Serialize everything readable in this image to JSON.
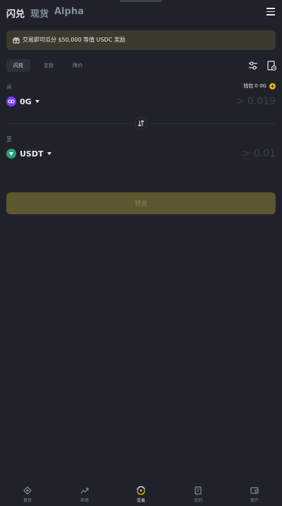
{
  "header": {
    "tabs": [
      {
        "label": "闪兑"
      },
      {
        "label": "现货"
      },
      {
        "label": "Alpha"
      }
    ],
    "menu_icon": "hamburger-menu-icon"
  },
  "banner": {
    "icon": "gift-icon",
    "text": "交易即可瓜分 $50,000 等值 USDC 奖励"
  },
  "subtabs": [
    {
      "label": "闪兑"
    },
    {
      "label": "定投"
    },
    {
      "label": "限价"
    }
  ],
  "from": {
    "label": "从",
    "balance_label": "钱包 0 0G",
    "token": "0G",
    "amount_placeholder": "> 0.019"
  },
  "to": {
    "label": "至",
    "token": "USDT",
    "amount_placeholder": "> 0.01"
  },
  "preview_button": "预览",
  "bottom_nav": [
    {
      "label": "首页",
      "icon": "home-diamond-icon"
    },
    {
      "label": "市场",
      "icon": "chart-icon"
    },
    {
      "label": "交易",
      "icon": "trade-swap-icon"
    },
    {
      "label": "合约",
      "icon": "contract-document-icon"
    },
    {
      "label": "资产",
      "icon": "wallet-icon"
    }
  ],
  "colors": {
    "background": "#1f2329",
    "accent_yellow": "#f0b90b",
    "banner_bg": "#3a3a2e",
    "preview_disabled": "#5c5631",
    "token_0g": "#7d3cff",
    "token_usdt": "#26a17b"
  }
}
